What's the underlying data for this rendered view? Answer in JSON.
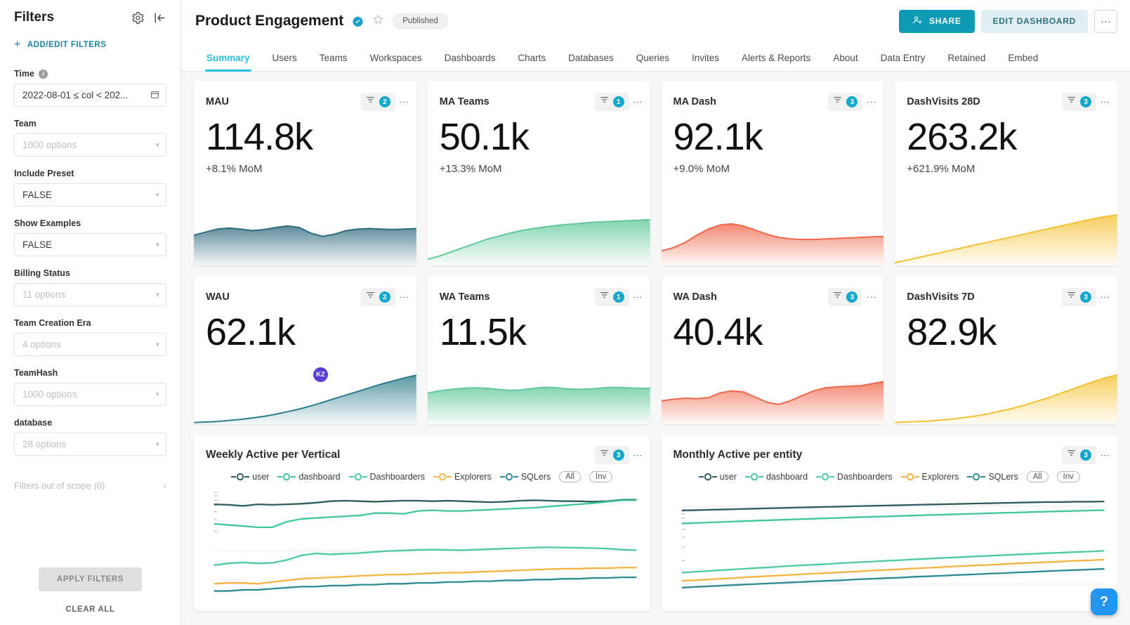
{
  "sidebar": {
    "title": "Filters",
    "gear_icon": "gear-icon",
    "collapse_icon": "collapse-panel-icon",
    "add_edit_label": "ADD/EDIT FILTERS",
    "filters": [
      {
        "label": "Time",
        "value": "2022-08-01 ≤ col < 202...",
        "control": "daterange",
        "has_info": true,
        "placeholder": false
      },
      {
        "label": "Team",
        "value": "1000 options",
        "control": "select",
        "has_info": false,
        "placeholder": true
      },
      {
        "label": "Include Preset",
        "value": "FALSE",
        "control": "select",
        "has_info": false,
        "placeholder": false
      },
      {
        "label": "Show Examples",
        "value": "FALSE",
        "control": "select",
        "has_info": false,
        "placeholder": false
      },
      {
        "label": "Billing Status",
        "value": "11 options",
        "control": "select",
        "has_info": false,
        "placeholder": true
      },
      {
        "label": "Team Creation Era",
        "value": "4 options",
        "control": "select",
        "has_info": false,
        "placeholder": true
      },
      {
        "label": "TeamHash",
        "value": "1000 options",
        "control": "select",
        "has_info": false,
        "placeholder": true
      },
      {
        "label": "database",
        "value": "28 options",
        "control": "select",
        "has_info": false,
        "placeholder": true
      }
    ],
    "out_of_scope": "Filters out of scope (0)",
    "apply_label": "APPLY FILTERS",
    "clear_label": "CLEAR ALL"
  },
  "header": {
    "title": "Product Engagement",
    "certified_icon": "certified-badge-icon",
    "star_icon": "star-icon",
    "status_pill": "Published",
    "share_label": "SHARE",
    "share_icon": "share-user-icon",
    "edit_label": "EDIT DASHBOARD",
    "more_label": "···",
    "accent_color": "#0f9ab5",
    "edit_color": "#e1eff2"
  },
  "tabs": {
    "active": "Summary",
    "items": [
      "Summary",
      "Users",
      "Teams",
      "Workspaces",
      "Dashboards",
      "Charts",
      "Databases",
      "Queries",
      "Invites",
      "Alerts & Reports",
      "About",
      "Data Entry",
      "Retained",
      "Embed"
    ],
    "active_color": "#2cc0e0"
  },
  "metric_cards": [
    {
      "title": "MAU",
      "value": "114.8k",
      "mom": "+8.1% MoM",
      "filter_count": "2",
      "kebab": true,
      "color": "#2d6b7d",
      "shape": "wave"
    },
    {
      "title": "MA Teams",
      "value": "50.1k",
      "mom": "+13.3% MoM",
      "filter_count": "1",
      "kebab": true,
      "color": "#63c99b",
      "shape": "rise"
    },
    {
      "title": "MA Dash",
      "value": "92.1k",
      "mom": "+9.0% MoM",
      "filter_count": "3",
      "kebab": true,
      "color": "#f0674a",
      "shape": "hump"
    },
    {
      "title": "DashVisits 28D",
      "value": "263.2k",
      "mom": "+621.9% MoM",
      "filter_count": "3",
      "kebab": true,
      "color": "#f5c132",
      "shape": "linear"
    },
    {
      "title": "WAU",
      "value": "62.1k",
      "mom": "",
      "filter_count": "2",
      "kebab": true,
      "color": "#2d7d8e",
      "shape": "curve",
      "avatar": "KZ",
      "avatar_color": "#5b3ed6"
    },
    {
      "title": "WA Teams",
      "value": "11.5k",
      "mom": "",
      "filter_count": "1",
      "kebab": true,
      "color": "#63c99b",
      "shape": "flat"
    },
    {
      "title": "WA Dash",
      "value": "40.4k",
      "mom": "",
      "filter_count": "3",
      "kebab": true,
      "color": "#f0674a",
      "shape": "bumpy"
    },
    {
      "title": "DashVisits 7D",
      "value": "82.9k",
      "mom": "",
      "filter_count": "3",
      "kebab": true,
      "color": "#f5c132",
      "shape": "expo"
    }
  ],
  "chart_data": [
    {
      "type": "line",
      "title": "Weekly Active per Vertical",
      "filter_count": "3",
      "legend_position": "top",
      "legend_pills": [
        "All",
        "Inv"
      ],
      "xlabel": "",
      "ylabel": "",
      "yscale": "log",
      "grid": true,
      "x": [
        1,
        2,
        3,
        4,
        5,
        6,
        7,
        8,
        9,
        10,
        11,
        12,
        13,
        14,
        15,
        16,
        17,
        18,
        19,
        20,
        21,
        22,
        23,
        24,
        25,
        26,
        27,
        28,
        29,
        30
      ],
      "series": [
        {
          "name": "user",
          "color": "#2d5d63",
          "values": [
            52,
            51,
            49,
            52,
            51,
            52,
            53,
            55,
            58,
            59,
            58,
            57,
            58,
            59,
            59,
            58,
            59,
            58,
            57,
            56,
            57,
            59,
            60,
            59,
            58,
            58,
            57,
            58,
            61,
            61
          ]
        },
        {
          "name": "dashboard",
          "color": "#3fc79a",
          "values": [
            26,
            25,
            24,
            23,
            23,
            28,
            31,
            32,
            33,
            34,
            35,
            38,
            38,
            37,
            41,
            42,
            41,
            41,
            42,
            43,
            44,
            45,
            46,
            48,
            50,
            52,
            54,
            57,
            60,
            60
          ]
        },
        {
          "name": "Dashboarders",
          "color": "#4ecb9b",
          "values": [
            6,
            6.4,
            6.6,
            6.4,
            6.5,
            7.2,
            8.5,
            9.1,
            8.8,
            9.0,
            9.2,
            9.6,
            9.9,
            10.1,
            10.3,
            10.4,
            10.3,
            10.2,
            10.4,
            10.6,
            10.8,
            11.0,
            11.2,
            11.3,
            11.2,
            11.1,
            11.0,
            10.8,
            10.4,
            10.2
          ]
        },
        {
          "name": "Explorers",
          "color": "#f5b341",
          "values": [
            3.1,
            3.2,
            3.2,
            3.1,
            3.3,
            3.5,
            3.7,
            3.8,
            3.9,
            4.0,
            4.1,
            4.2,
            4.3,
            4.3,
            4.4,
            4.5,
            4.6,
            4.6,
            4.7,
            4.8,
            4.9,
            5.0,
            5.1,
            5.2,
            5.3,
            5.3,
            5.4,
            5.4,
            5.5,
            5.5
          ]
        },
        {
          "name": "SQLers",
          "color": "#2d8b93",
          "values": [
            2.4,
            2.4,
            2.5,
            2.5,
            2.6,
            2.7,
            2.8,
            2.8,
            2.9,
            2.9,
            3.0,
            3.0,
            3.1,
            3.1,
            3.2,
            3.2,
            3.3,
            3.3,
            3.4,
            3.4,
            3.5,
            3.5,
            3.6,
            3.6,
            3.7,
            3.7,
            3.8,
            3.8,
            3.9,
            3.9
          ]
        }
      ]
    },
    {
      "type": "line",
      "title": "Monthly Active per entity",
      "filter_count": "3",
      "legend_position": "top",
      "legend_pills": [
        "All",
        "Inv"
      ],
      "xlabel": "",
      "ylabel": "",
      "yscale": "log",
      "grid": true,
      "x": [
        1,
        2,
        3,
        4,
        5,
        6,
        7,
        8,
        9,
        10,
        11,
        12,
        13,
        14,
        15,
        16,
        17,
        18,
        19,
        20,
        21,
        22,
        23,
        24,
        25,
        26,
        27,
        28,
        29,
        30
      ],
      "series": [
        {
          "name": "user",
          "color": "#2d5d63",
          "values": [
            88,
            89,
            90,
            91,
            92,
            93,
            94,
            95,
            96,
            97,
            98,
            99,
            100,
            101,
            102,
            103,
            104,
            105,
            106,
            107,
            108,
            109,
            110,
            111,
            112,
            113,
            113,
            114,
            114,
            115
          ]
        },
        {
          "name": "dashboard",
          "color": "#3fc79a",
          "values": [
            60,
            61,
            62,
            63,
            64,
            65,
            66,
            67,
            68,
            69,
            70,
            71,
            72,
            73,
            74,
            75,
            76,
            77,
            78,
            79,
            80,
            81,
            82,
            83,
            84,
            85,
            86,
            87,
            88,
            89
          ]
        },
        {
          "name": "Dashboarders",
          "color": "#4ecb9b",
          "values": [
            14,
            14.4,
            14.8,
            15.2,
            15.6,
            16,
            16.4,
            16.9,
            17.3,
            17.7,
            18.1,
            18.6,
            19,
            19.4,
            19.9,
            20.3,
            20.8,
            21.2,
            21.7,
            22.1,
            22.6,
            23,
            23.5,
            24,
            24.4,
            24.9,
            25.3,
            25.8,
            26.2,
            26.7
          ]
        },
        {
          "name": "Explorers",
          "color": "#f5b341",
          "values": [
            11,
            11.2,
            11.5,
            11.8,
            12.1,
            12.4,
            12.7,
            13,
            13.3,
            13.6,
            13.9,
            14.2,
            14.5,
            14.9,
            15.2,
            15.5,
            15.9,
            16.2,
            16.6,
            16.9,
            17.3,
            17.6,
            18,
            18.4,
            18.7,
            19.1,
            19.5,
            19.9,
            20.2,
            20.6
          ]
        },
        {
          "name": "SQLers",
          "color": "#2d8b93",
          "values": [
            9,
            9.2,
            9.4,
            9.6,
            9.8,
            10,
            10.2,
            10.4,
            10.6,
            10.8,
            11,
            11.2,
            11.5,
            11.7,
            11.9,
            12.1,
            12.4,
            12.6,
            12.8,
            13.1,
            13.3,
            13.6,
            13.8,
            14.1,
            14.3,
            14.6,
            14.9,
            15.1,
            15.4,
            15.7
          ]
        }
      ]
    }
  ],
  "help": {
    "label": "?"
  }
}
